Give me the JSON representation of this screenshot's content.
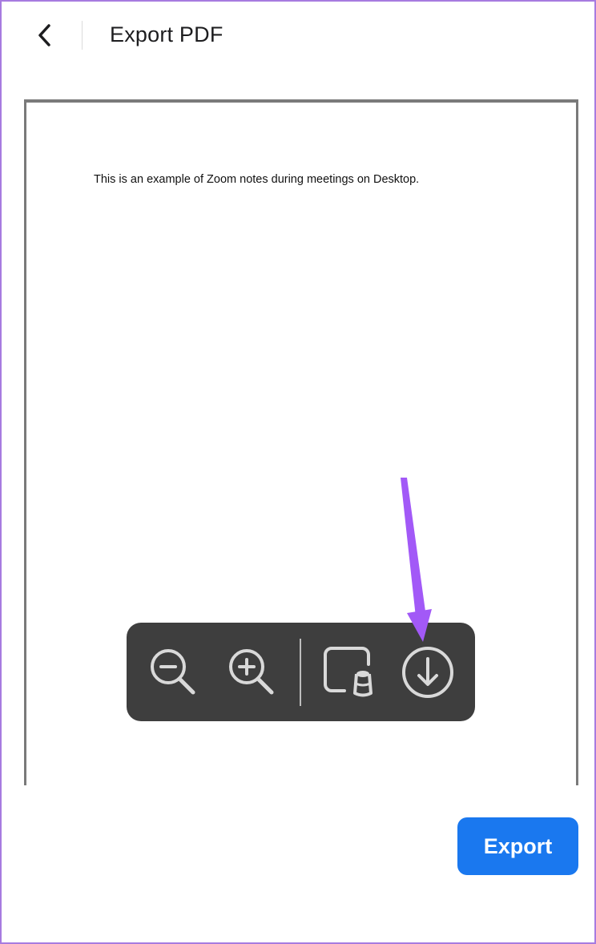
{
  "header": {
    "title": "Export PDF",
    "back_icon": "chevron-left-icon"
  },
  "document": {
    "text": "This is an example of Zoom notes during meetings on Desktop."
  },
  "toolbar": {
    "icons": [
      "zoom-out-icon",
      "zoom-in-icon",
      "markup-icon",
      "download-icon"
    ],
    "background": "#3e3e3e",
    "icon_color": "#d9d9d9"
  },
  "annotation": {
    "arrow_color": "#a259f7",
    "points_to": "download-icon"
  },
  "footer": {
    "export_label": "Export",
    "accent": "#1a78ef"
  },
  "colors": {
    "frame": "#a77be0"
  }
}
